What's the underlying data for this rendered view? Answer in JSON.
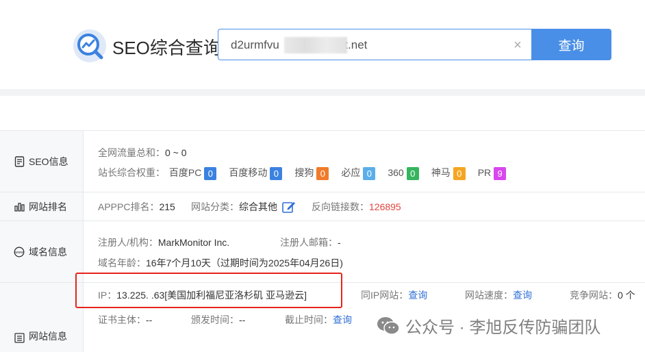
{
  "header": {
    "logo_text": "SEO综合查询",
    "search_value": "d2urmfvu            dfront.net",
    "search_button": "查询"
  },
  "seo": {
    "title": "SEO信息",
    "traffic_label": "全网流量总和：",
    "traffic_value": "0 ~ 0",
    "weight_label": "站长综合权重：",
    "weights": [
      {
        "name": "百度PC",
        "value": "0",
        "color": "#3b82e0"
      },
      {
        "name": "百度移动",
        "value": "0",
        "color": "#3b82e0"
      },
      {
        "name": "搜狗",
        "value": "0",
        "color": "#f07b2b"
      },
      {
        "name": "必应",
        "value": "0",
        "color": "#5aaeea"
      },
      {
        "name": "360",
        "value": "0",
        "color": "#35b55e"
      },
      {
        "name": "神马",
        "value": "0",
        "color": "#f4a623"
      },
      {
        "name": "PR",
        "value": "9",
        "color": "#d946ef"
      }
    ]
  },
  "rank": {
    "title": "网站排名",
    "apppc_label": "APPPC排名：",
    "apppc_value": "215",
    "category_label": "网站分类：",
    "category_value": "综合其他",
    "backlinks_label": "反向链接数：",
    "backlinks_value": "126895"
  },
  "domain": {
    "title": "域名信息",
    "registrant_label": "注册人/机构：",
    "registrant_value": "MarkMonitor Inc.",
    "email_label": "注册人邮箱：",
    "email_value": "-",
    "age_label": "域名年龄：",
    "age_value": "16年7个月10天（过期时间为2025年04月26日)"
  },
  "site": {
    "title": "网站信息",
    "ip_label": "IP：",
    "ip_value": "13.225.    .63[美国加利福尼亚洛杉矶 亚马逊云]",
    "same_ip_label": "同IP网站：",
    "same_ip_link": "查询",
    "speed_label": "网站速度：",
    "speed_link": "查询",
    "compete_label": "竞争网站：",
    "compete_value": "0 个",
    "cert_label": "证书主体：",
    "cert_value": "--",
    "issue_label": "颁发时间：",
    "issue_value": "--",
    "expire_label": "截止时间：",
    "expire_link": "查询"
  },
  "watermark": {
    "text": "公众号 · 李旭反传防骗团队"
  }
}
